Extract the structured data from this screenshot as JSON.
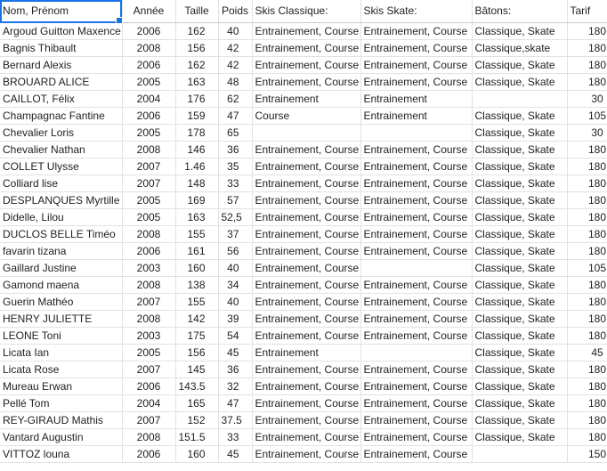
{
  "columns": [
    "Nom, Prénom",
    "Année",
    "Taille",
    "Poids",
    "Skis Classique:",
    "Skis Skate:",
    "Bâtons:",
    "Tarif"
  ],
  "rows": [
    [
      "Argoud Guitton Maxence",
      "2006",
      "162",
      "40",
      "Entrainement, Course",
      "Entrainement, Course",
      "Classique, Skate",
      "180"
    ],
    [
      "Bagnis Thibault",
      "2008",
      "156",
      "42",
      "Entrainement, Course",
      "Entrainement, Course",
      "Classique,skate",
      "180"
    ],
    [
      "Bernard Alexis",
      "2006",
      "162",
      "42",
      "Entrainement, Course",
      "Entrainement, Course",
      "Classique, Skate",
      "180"
    ],
    [
      "BROUARD ALICE",
      "2005",
      "163",
      "48",
      "Entrainement, Course",
      "Entrainement, Course",
      "Classique, Skate",
      "180"
    ],
    [
      "CAILLOT, Félix",
      "2004",
      "176",
      "62",
      "Entrainement",
      "Entrainement",
      "",
      "30"
    ],
    [
      "Champagnac Fantine",
      "2006",
      "159",
      "47",
      "Course",
      "Entrainement",
      "Classique, Skate",
      "105"
    ],
    [
      "Chevalier Loris",
      "2005",
      "178",
      "65",
      "",
      "",
      "Classique, Skate",
      "30"
    ],
    [
      "Chevalier Nathan",
      "2008",
      "146",
      "36",
      "Entrainement, Course",
      "Entrainement, Course",
      "Classique, Skate",
      "180"
    ],
    [
      "COLLET Ulysse",
      "2007",
      "1.46",
      "35",
      "Entrainement, Course",
      "Entrainement, Course",
      "Classique, Skate",
      "180"
    ],
    [
      "Colliard lise",
      "2007",
      "148",
      "33",
      "Entrainement, Course",
      "Entrainement, Course",
      "Classique, Skate",
      "180"
    ],
    [
      "DESPLANQUES Myrtille",
      "2005",
      "169",
      "57",
      "Entrainement, Course",
      "Entrainement, Course",
      "Classique, Skate",
      "180"
    ],
    [
      "Didelle, Lilou",
      "2005",
      "163",
      "52,5",
      "Entrainement, Course",
      "Entrainement, Course",
      "Classique, Skate",
      "180"
    ],
    [
      "DUCLOS BELLE Timéo",
      "2008",
      "155",
      "37",
      "Entrainement, Course",
      "Entrainement, Course",
      "Classique, Skate",
      "180"
    ],
    [
      "favarin tizana",
      "2006",
      "161",
      "56",
      "Entrainement, Course",
      "Entrainement, Course",
      "Classique, Skate",
      "180"
    ],
    [
      "Gaillard Justine",
      "2003",
      "160",
      "40",
      "Entrainement, Course",
      "",
      "Classique, Skate",
      "105"
    ],
    [
      "Gamond maena",
      "2008",
      "138",
      "34",
      "Entrainement, Course",
      "Entrainement, Course",
      "Classique, Skate",
      "180"
    ],
    [
      "Guerin Mathéo",
      "2007",
      "155",
      "40",
      "Entrainement, Course",
      "Entrainement, Course",
      "Classique, Skate",
      "180"
    ],
    [
      "HENRY JULIETTE",
      "2008",
      "142",
      "39",
      "Entrainement, Course",
      "Entrainement, Course",
      "Classique, Skate",
      "180"
    ],
    [
      "LEONE Toni",
      "2003",
      "175",
      "54",
      "Entrainement, Course",
      "Entrainement, Course",
      "Classique, Skate",
      "180"
    ],
    [
      "Licata Ian",
      "2005",
      "156",
      "45",
      "Entrainement",
      "",
      "Classique, Skate",
      "45"
    ],
    [
      "Licata Rose",
      "2007",
      "145",
      "36",
      "Entrainement, Course",
      "Entrainement, Course",
      "Classique, Skate",
      "180"
    ],
    [
      "Mureau Erwan",
      "2006",
      "143.5",
      "32",
      "Entrainement, Course",
      "Entrainement, Course",
      "Classique, Skate",
      "180"
    ],
    [
      "Pellé Tom",
      "2004",
      "165",
      "47",
      "Entrainement, Course",
      "Entrainement, Course",
      "Classique, Skate",
      "180"
    ],
    [
      "REY-GIRAUD Mathis",
      "2007",
      "152",
      "37.5",
      "Entrainement, Course",
      "Entrainement, Course",
      "Classique, Skate",
      "180"
    ],
    [
      "Vantard Augustin",
      "2008",
      "151.5",
      "33",
      "Entrainement, Course",
      "Entrainement, Course",
      "Classique, Skate",
      "180"
    ],
    [
      "VITTOZ louna",
      "2006",
      "160",
      "45",
      "Entrainement, Course",
      "Entrainement, Course",
      "",
      "150"
    ]
  ]
}
